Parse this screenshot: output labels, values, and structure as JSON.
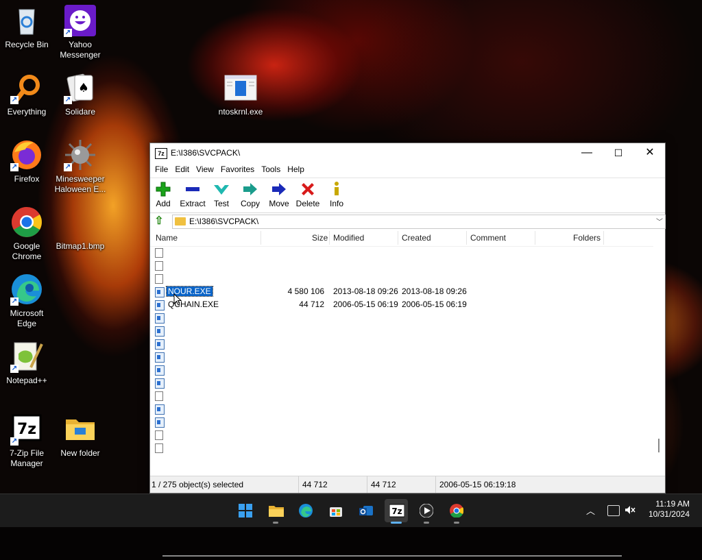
{
  "desktop": {
    "icons": [
      {
        "label": "Recycle Bin"
      },
      {
        "label": "Yahoo Messenger"
      },
      {
        "label": "Everything"
      },
      {
        "label": "Solidare"
      },
      {
        "label": "ntoskrnl.exe"
      },
      {
        "label": "Firefox"
      },
      {
        "label": "Minesweeper Haloween E..."
      },
      {
        "label": "Google Chrome"
      },
      {
        "label": "Bitmap1.bmp"
      },
      {
        "label": "Microsoft Edge"
      },
      {
        "label": "Notepad++"
      },
      {
        "label": "7-Zip File Manager"
      },
      {
        "label": "New folder"
      }
    ]
  },
  "window": {
    "app_icon_text": "7z",
    "title": "E:\\I386\\SVCPACK\\",
    "controls": {
      "minimize": "—",
      "maximize": "☐",
      "close": "✕"
    },
    "menu": [
      "File",
      "Edit",
      "View",
      "Favorites",
      "Tools",
      "Help"
    ],
    "toolbar": [
      {
        "label": "Add",
        "icon": "plus-icon",
        "color": "#1aa31a"
      },
      {
        "label": "Extract",
        "icon": "minus-icon",
        "color": "#1a2ab8"
      },
      {
        "label": "Test",
        "icon": "check-icon",
        "color": "#1fb8b0"
      },
      {
        "label": "Copy",
        "icon": "copy-arrow-icon",
        "color": "#1a9c8c"
      },
      {
        "label": "Move",
        "icon": "move-arrow-icon",
        "color": "#1a2ab8"
      },
      {
        "label": "Delete",
        "icon": "delete-x-icon",
        "color": "#d81a1a"
      },
      {
        "label": "Info",
        "icon": "info-icon",
        "color": "#c8a800"
      }
    ],
    "address": "E:\\I386\\SVCPACK\\",
    "columns": {
      "name": "Name",
      "size": "Size",
      "modified": "Modified",
      "created": "Created",
      "comment": "Comment",
      "folders": "Folders"
    },
    "rows": [
      {
        "type": "doc",
        "name": "",
        "size": "",
        "modified": "",
        "created": ""
      },
      {
        "type": "doc",
        "name": "",
        "size": "",
        "modified": "",
        "created": ""
      },
      {
        "type": "doc",
        "name": "",
        "size": "",
        "modified": "",
        "created": ""
      },
      {
        "type": "exe",
        "name": "NOUR.EXE",
        "size": "4 580 106",
        "modified": "2013-08-18 09:26",
        "created": "2013-08-18 09:26",
        "selected": true
      },
      {
        "type": "exe",
        "name": "QCHAIN.EXE",
        "size": "44 712",
        "modified": "2006-05-15 06:19",
        "created": "2006-05-15 06:19"
      },
      {
        "type": "exe",
        "name": "",
        "size": "",
        "modified": "",
        "created": ""
      },
      {
        "type": "exe",
        "name": "",
        "size": "",
        "modified": "",
        "created": ""
      },
      {
        "type": "exe",
        "name": "",
        "size": "",
        "modified": "",
        "created": ""
      },
      {
        "type": "exe",
        "name": "",
        "size": "",
        "modified": "",
        "created": ""
      },
      {
        "type": "exe",
        "name": "",
        "size": "",
        "modified": "",
        "created": ""
      },
      {
        "type": "exe",
        "name": "",
        "size": "",
        "modified": "",
        "created": ""
      },
      {
        "type": "doc",
        "name": "",
        "size": "",
        "modified": "",
        "created": ""
      },
      {
        "type": "exe",
        "name": "",
        "size": "",
        "modified": "",
        "created": ""
      },
      {
        "type": "exe",
        "name": "",
        "size": "",
        "modified": "",
        "created": ""
      },
      {
        "type": "doc",
        "name": "",
        "size": "",
        "modified": "",
        "created": ""
      },
      {
        "type": "doc",
        "name": "",
        "size": "",
        "modified": "",
        "created": ""
      }
    ],
    "status": {
      "selection": "1 / 275 object(s) selected",
      "size": "44 712",
      "packed": "44 712",
      "date": "2006-05-15 06:19:18"
    }
  },
  "taskbar": {
    "apps": [
      "start-icon",
      "file-explorer-icon",
      "edge-icon",
      "store-icon",
      "outlook-icon",
      "7zip-icon",
      "media-player-icon",
      "chrome-icon"
    ],
    "active_app": "7zip-icon",
    "clock": {
      "time": "11:19 AM",
      "date": "10/31/2024"
    }
  }
}
